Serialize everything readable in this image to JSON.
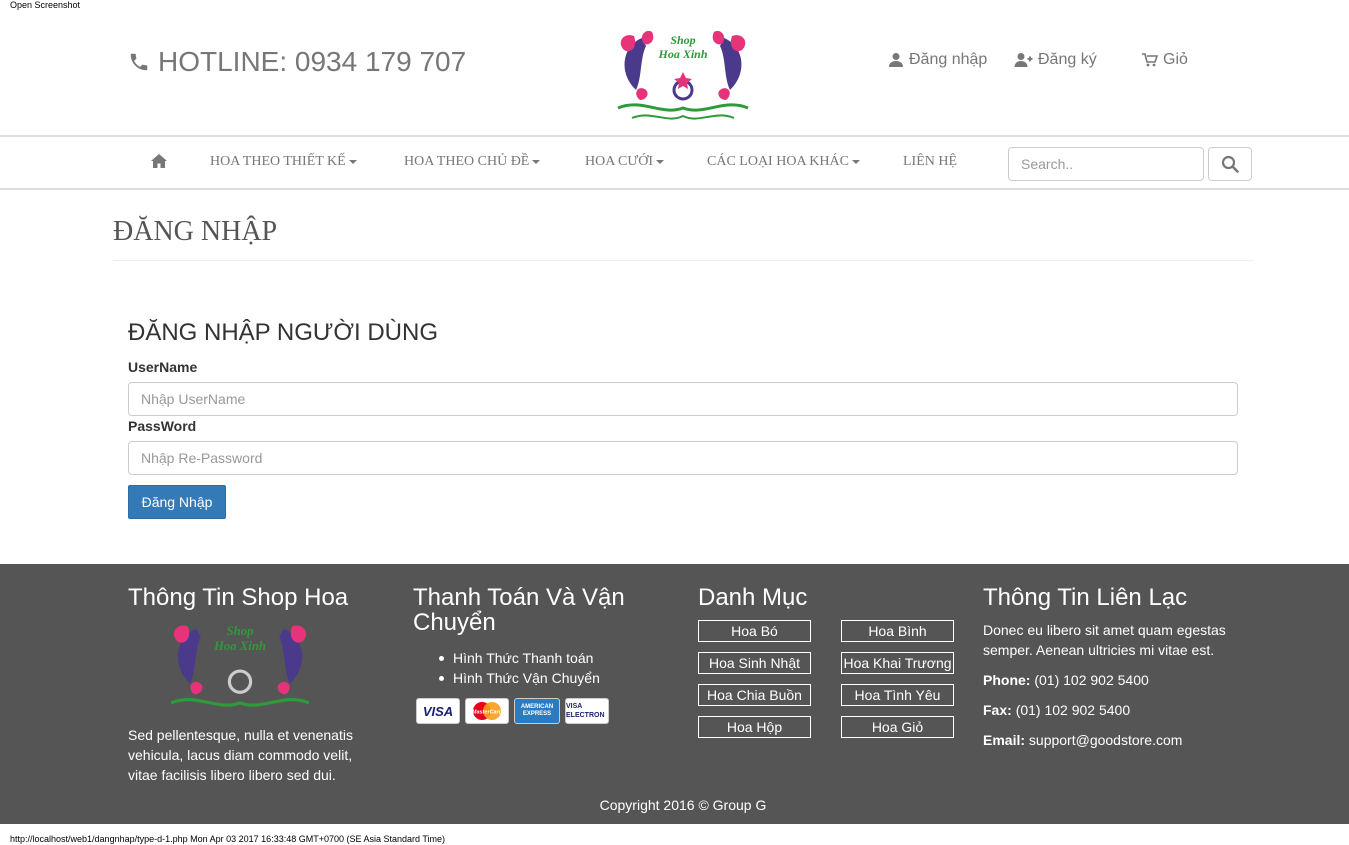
{
  "browser": {
    "top_label": "Open Screenshot",
    "status_line": "http://localhost/web1/dangnhap/type-d-1.php Mon Apr 03 2017 16:33:48 GMT+0700 (SE Asia Standard Time)"
  },
  "header": {
    "hotline": "HOTLINE: 0934 179 707",
    "logo_text_line1": "Shop",
    "logo_text_line2": "Hoa Xinh",
    "login": "Đăng nhập",
    "register": "Đăng ký",
    "cart": "Giỏ"
  },
  "nav": {
    "items": [
      {
        "label": "HOA THEO THIẾT KẾ",
        "dropdown": true
      },
      {
        "label": "HOA THEO CHỦ ĐỀ",
        "dropdown": true
      },
      {
        "label": "HOA CƯỚI",
        "dropdown": true
      },
      {
        "label": "CÁC LOẠI HOA KHÁC",
        "dropdown": true
      },
      {
        "label": "LIÊN HỆ",
        "dropdown": false
      }
    ],
    "search_placeholder": "Search.."
  },
  "page": {
    "title": "ĐĂNG NHẬP"
  },
  "form": {
    "heading": "ĐĂNG NHẬP NGƯỜI DÙNG",
    "username_label": "UserName",
    "username_placeholder": "Nhập UserName",
    "password_label": "PassWord",
    "password_placeholder": "Nhập Re-Password",
    "submit": "Đăng Nhập"
  },
  "footer": {
    "col1": {
      "title": "Thông Tin Shop Hoa",
      "description": "Sed pellentesque, nulla et venenatis vehicula, lacus diam commodo velit, vitae facilisis libero libero sed dui."
    },
    "col2": {
      "title_line1": "Thanh Toán Và Vận",
      "title_line2": "Chuyển",
      "links": [
        "Hình Thức Thanh toán",
        "Hình Thức Vận Chuyển"
      ],
      "cards": [
        "VISA",
        "MasterCard",
        "AMERICAN EXPRESS",
        "VISA ELECTRON"
      ]
    },
    "col3": {
      "title": "Danh Mục",
      "categories": [
        "Hoa Bó",
        "Hoa Bình",
        "Hoa Sinh Nhật",
        "Hoa Khai Trương",
        "Hoa Chia Buồn",
        "Hoa Tình Yêu",
        "Hoa Hộp",
        "Hoa Giỏ"
      ]
    },
    "col4": {
      "title": "Thông Tin Liên Lạc",
      "description": "Donec eu libero sit amet quam egestas semper. Aenean ultricies mi vitae est.",
      "phone_label": "Phone:",
      "phone": "(01) 102 902 5400",
      "fax_label": "Fax:",
      "fax": "(01) 102 902 5400",
      "email_label": "Email:",
      "email": "support@goodstore.com"
    },
    "copyright": "Copyright 2016 © Group G"
  },
  "colors": {
    "primary_button": "#337ab7",
    "footer_bg": "#555555",
    "muted_text": "#777777"
  },
  "icons": [
    "phone-icon",
    "user-icon",
    "user-plus-icon",
    "cart-icon",
    "home-icon",
    "search-icon"
  ]
}
